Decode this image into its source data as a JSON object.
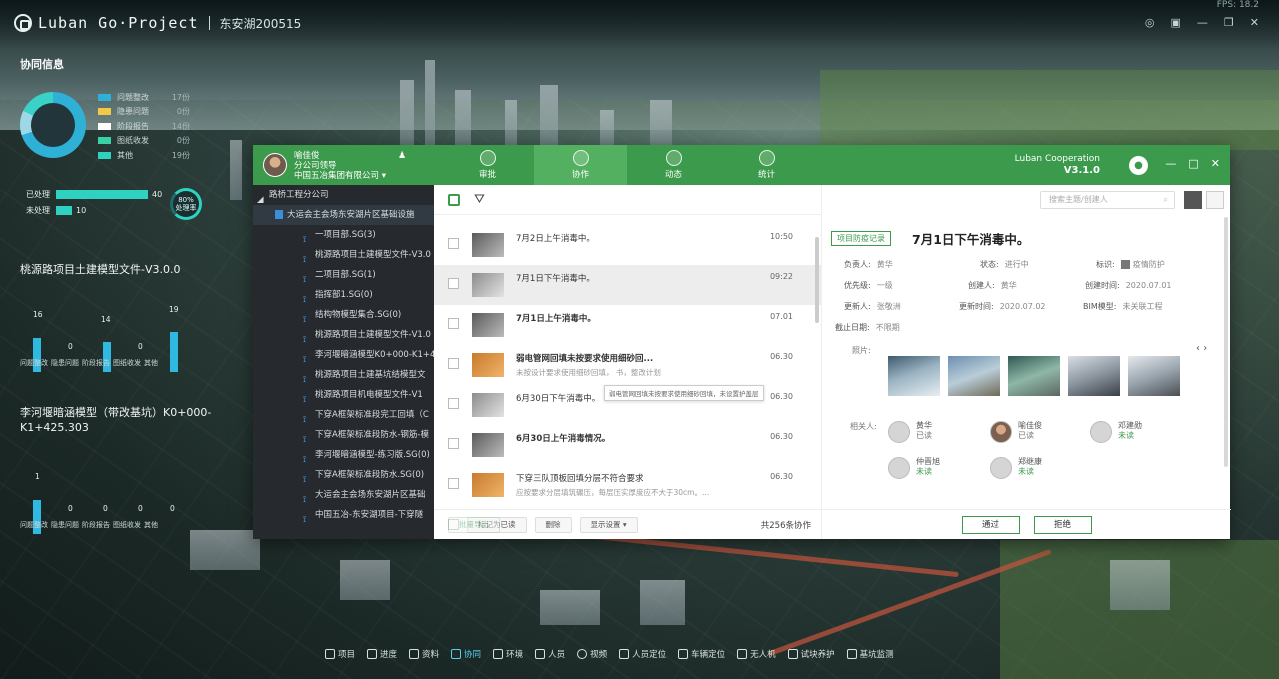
{
  "app": {
    "logo_text": "Luban Go·Project",
    "project_name": "东安湖200515",
    "fps": "FPS: 18.2"
  },
  "left_panel": {
    "section_title": "协同信息",
    "donut_legend": [
      {
        "label": "问题整改",
        "value": "17份",
        "color": "#2fb0d6"
      },
      {
        "label": "隐患问题",
        "value": "0份",
        "color": "#f2c84b"
      },
      {
        "label": "阶段报告",
        "value": "14份",
        "color": "#ffffff"
      },
      {
        "label": "图纸收发",
        "value": "0份",
        "color": "#3ad1a5"
      },
      {
        "label": "其他",
        "value": "19份",
        "color": "#2fd1c1"
      }
    ],
    "processed": {
      "label": "已处理",
      "value": "40"
    },
    "unprocessed": {
      "label": "未处理",
      "value": "10"
    },
    "ring": {
      "percent": "80%",
      "label": "处理率"
    },
    "model1": {
      "title": "桃源路项目土建模型文件-V3.0.0",
      "categories": [
        "问题整改",
        "隐患问题",
        "阶段报告",
        "图纸收发",
        "其他"
      ],
      "values": [
        "16",
        "0",
        "14",
        "0",
        "19"
      ]
    },
    "model2": {
      "title": "李河堰暗涵模型（带改基坑）K0+000-K1+425.303",
      "categories": [
        "问题整改",
        "隐患问题",
        "阶段报告",
        "图纸收发",
        "其他"
      ],
      "values": [
        "1",
        "0",
        "0",
        "0",
        "0"
      ]
    }
  },
  "dialog": {
    "user": {
      "name": "喻佳俊",
      "role": "分公司领导",
      "company": "中国五冶集团有限公司"
    },
    "tabs": [
      {
        "label": "审批",
        "active": false
      },
      {
        "label": "协作",
        "active": true
      },
      {
        "label": "动态",
        "active": false
      },
      {
        "label": "统计",
        "active": false
      }
    ],
    "brand_name": "Luban Cooperation",
    "brand_version": "V3.1.0",
    "tree": {
      "root": "路桥工程分公司",
      "project": "大运会主会场东安湖片区基础设施",
      "items": [
        "一项目部.SG(3)",
        "桃源路项目土建模型文件-V3.0",
        "二项目部.SG(1)",
        "指挥部1.SG(0)",
        "结构物模型集合.SG(0)",
        "桃源路项目土建模型文件-V1.0",
        "李河堰暗涵模型K0+000-K1+4",
        "桃源路项目土建基坑结模型文",
        "桃源路项目机电模型文件-V1",
        "下穿A框架标准段完工回填（C",
        "下穿A框架标准段防水-钢筋-模",
        "李河堰暗涵模型-练习版.SG(0)",
        "下穿A框架标准段防水.SG(0)",
        "大运会主会场东安湖片区基础",
        "中国五冶-东安湖项目-下穿隧"
      ]
    },
    "list": {
      "rows": [
        {
          "title": "7月2日上午消毒中。",
          "subtitle": "",
          "time": "10:50",
          "bold": false,
          "thumb": "dark"
        },
        {
          "title": "7月1日下午消毒中。",
          "subtitle": "",
          "time": "09:22",
          "bold": false,
          "thumb": "grey"
        },
        {
          "title": "7月1日上午消毒中。",
          "subtitle": "",
          "time": "07.01",
          "bold": true,
          "thumb": "dark"
        },
        {
          "title": "弱电管网回填未按要求使用细砂回...",
          "subtitle": "未按设计要求使用细砂回填，    书，整改计划",
          "time": "06.30",
          "bold": false,
          "thumb": "warm"
        },
        {
          "title": "6月30日下午消毒中。",
          "subtitle": "",
          "time": "06.30",
          "bold": false,
          "thumb": "grey"
        },
        {
          "title": "6月30日上午消毒情况。",
          "subtitle": "",
          "time": "06.30",
          "bold": true,
          "thumb": "dark"
        },
        {
          "title": "下穿三队顶板回填分层不符合要求",
          "subtitle": "应按要求分层填筑碾压，每层压实厚度应不大于30cm。...",
          "time": "06.30",
          "bold": false,
          "thumb": "warm"
        }
      ],
      "tooltip": "弱电管网回填未按要求使用细砂回填，未设置护盖层",
      "footer": {
        "mark_read": "标记为已读",
        "delete": "删除",
        "display_settings": "显示设置",
        "batch_export": "批量导出",
        "total": "共256条协作"
      }
    },
    "search_placeholder": "搜索主题/创建人",
    "detail": {
      "tag": "项目防疫记录",
      "title": "7月1日下午消毒中。",
      "fields": {
        "owner": {
          "label": "负责人:",
          "value": "黄华"
        },
        "status": {
          "label": "状态:",
          "value": "进行中"
        },
        "mark": {
          "label": "标识:",
          "value": "疫情防护"
        },
        "priority": {
          "label": "优先级:",
          "value": "一级"
        },
        "creator": {
          "label": "创建人:",
          "value": "黄华"
        },
        "created": {
          "label": "创建时间:",
          "value": "2020.07.01"
        },
        "updater": {
          "label": "更新人:",
          "value": "张敬洲"
        },
        "updated": {
          "label": "更新时间:",
          "value": "2020.07.02"
        },
        "bim": {
          "label": "BIM模型:",
          "value": "未关联工程"
        },
        "deadline": {
          "label": "截止日期:",
          "value": "不限期"
        }
      },
      "photos_label": "照片:",
      "people_label": "相关人:",
      "people": [
        {
          "name": "黄华",
          "state": "已读",
          "read": true
        },
        {
          "name": "喻佳俊",
          "state": "已读",
          "read": true
        },
        {
          "name": "邓建勋",
          "state": "未读",
          "read": false
        },
        {
          "name": "仲晋旭",
          "state": "未读",
          "read": false
        },
        {
          "name": "郑继康",
          "state": "未读",
          "read": false
        }
      ],
      "approve": "通过",
      "reject": "拒绝"
    }
  },
  "bottom_bar": [
    {
      "label": "项目",
      "active": false
    },
    {
      "label": "进度",
      "active": false
    },
    {
      "label": "资料",
      "active": false
    },
    {
      "label": "协同",
      "active": true
    },
    {
      "label": "环境",
      "active": false
    },
    {
      "label": "人员",
      "active": false
    },
    {
      "label": "视频",
      "active": false
    },
    {
      "label": "人员定位",
      "active": false
    },
    {
      "label": "车辆定位",
      "active": false
    },
    {
      "label": "无人机",
      "active": false
    },
    {
      "label": "试块养护",
      "active": false
    },
    {
      "label": "基坑监测",
      "active": false
    }
  ]
}
